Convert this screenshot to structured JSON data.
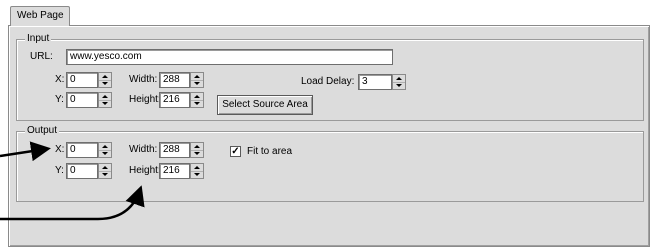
{
  "tab": {
    "label": "Web Page"
  },
  "input": {
    "title": "Input",
    "url_label": "URL:",
    "url_value": "www.yesco.com",
    "x_label": "X:",
    "x_value": "0",
    "y_label": "Y:",
    "y_value": "0",
    "width_label": "Width:",
    "width_value": "288",
    "height_label": "Height:",
    "height_value": "216",
    "load_delay_label": "Load Delay:",
    "load_delay_value": "3",
    "select_source_button": "Select Source Area"
  },
  "output": {
    "title": "Output",
    "x_label": "X:",
    "x_value": "0",
    "y_label": "Y:",
    "y_value": "0",
    "width_label": "Width:",
    "width_value": "288",
    "height_label": "Height:",
    "height_value": "216",
    "fit_checkbox_mark": "✓",
    "fit_label": "Fit to area"
  },
  "colors": {
    "panel": "#dcdcdc",
    "arrow": "#000000"
  }
}
